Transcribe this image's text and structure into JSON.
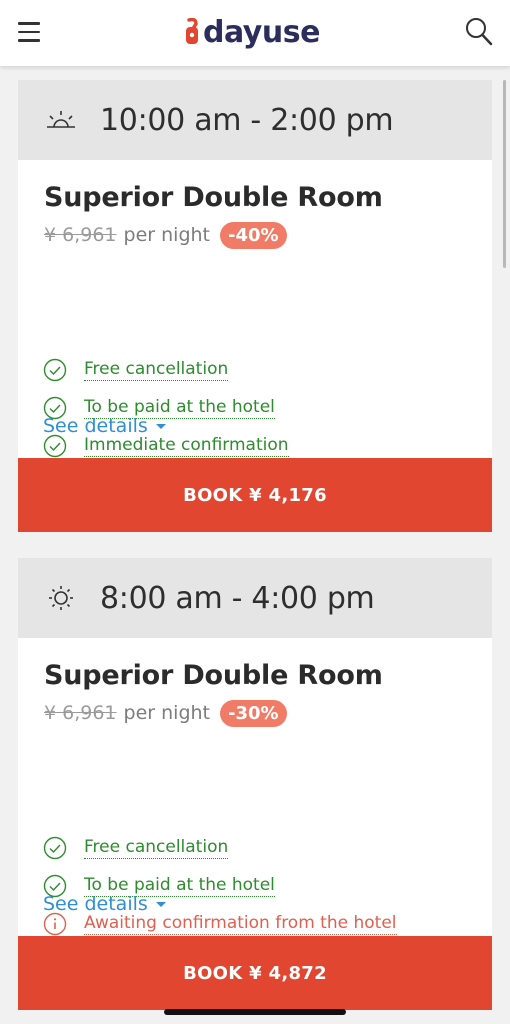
{
  "header": {
    "logo_text": "dayuse",
    "menu_icon": "hamburger-menu-icon",
    "search_icon": "search-icon",
    "brand_color": "#e04630",
    "logo_text_color": "#2b2d5c"
  },
  "offers": [
    {
      "time_icon": "sunrise-icon",
      "time": "10:00 am - 2:00 pm",
      "room": "Superior Double Room",
      "old_price": "¥ 6,961",
      "per_night": "per night",
      "discount": "-40%",
      "features": [
        {
          "label": "Free cancellation",
          "icon": "check-circle-icon",
          "status": "ok"
        },
        {
          "label": "To be paid at the hotel",
          "icon": "check-circle-icon",
          "status": "ok"
        },
        {
          "label": "Immediate confirmation",
          "icon": "check-circle-icon",
          "status": "ok"
        }
      ],
      "see_details": "See details",
      "book_label": "BOOK ¥ 4,176"
    },
    {
      "time_icon": "sun-icon",
      "time": "8:00 am - 4:00 pm",
      "room": "Superior Double Room",
      "old_price": "¥ 6,961",
      "per_night": "per night",
      "discount": "-30%",
      "features": [
        {
          "label": "Free cancellation",
          "icon": "check-circle-icon",
          "status": "ok"
        },
        {
          "label": "To be paid at the hotel",
          "icon": "check-circle-icon",
          "status": "ok"
        },
        {
          "label": "Awaiting confirmation from the hotel",
          "icon": "info-circle-icon",
          "status": "warning"
        }
      ],
      "see_details": "See details",
      "book_label": "BOOK ¥ 4,872"
    }
  ],
  "colors": {
    "ok": "#2d8c2d",
    "warning": "#e0604f",
    "link": "#2f8fd6",
    "discount_badge": "#f07c67",
    "card_header_bg": "#e5e5e5"
  }
}
